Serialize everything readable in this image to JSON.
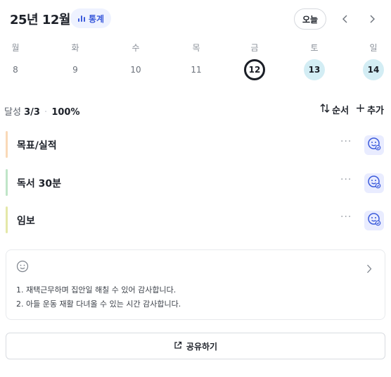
{
  "header": {
    "month_title": "25년 12월",
    "stats_label": "통계",
    "today_label": "오늘"
  },
  "week": [
    {
      "weekday": "월",
      "date": "8",
      "state": "past"
    },
    {
      "weekday": "화",
      "date": "9",
      "state": "past"
    },
    {
      "weekday": "수",
      "date": "10",
      "state": "past"
    },
    {
      "weekday": "목",
      "date": "11",
      "state": "past"
    },
    {
      "weekday": "금",
      "date": "12",
      "state": "today"
    },
    {
      "weekday": "토",
      "date": "13",
      "state": "future"
    },
    {
      "weekday": "일",
      "date": "14",
      "state": "future"
    }
  ],
  "summary": {
    "label": "달성",
    "count": "3/3",
    "percent": "100%"
  },
  "actions": {
    "order_label": "순서",
    "add_label": "추가"
  },
  "habits": [
    {
      "name": "목표/실적",
      "color": "#f9d9b8",
      "more": "···"
    },
    {
      "name": "독서 30분",
      "color": "#bfe5c8",
      "more": "···"
    },
    {
      "name": "임보",
      "color": "#e4e8a8",
      "more": "···"
    }
  ],
  "journal": {
    "lines": [
      "1. 재택근무하며 집안일 해칠 수 있어 감사합니다.",
      "2. 아들 운동 재활 다녀올 수 있는 시간 감사합니다."
    ]
  },
  "share": {
    "label": "공유하기"
  },
  "colors": {
    "accent": "#3b5bdb",
    "chip_bg": "#eef2ff",
    "future_day_bg": "#d3edf4",
    "check_bg": "#e9ecff"
  }
}
